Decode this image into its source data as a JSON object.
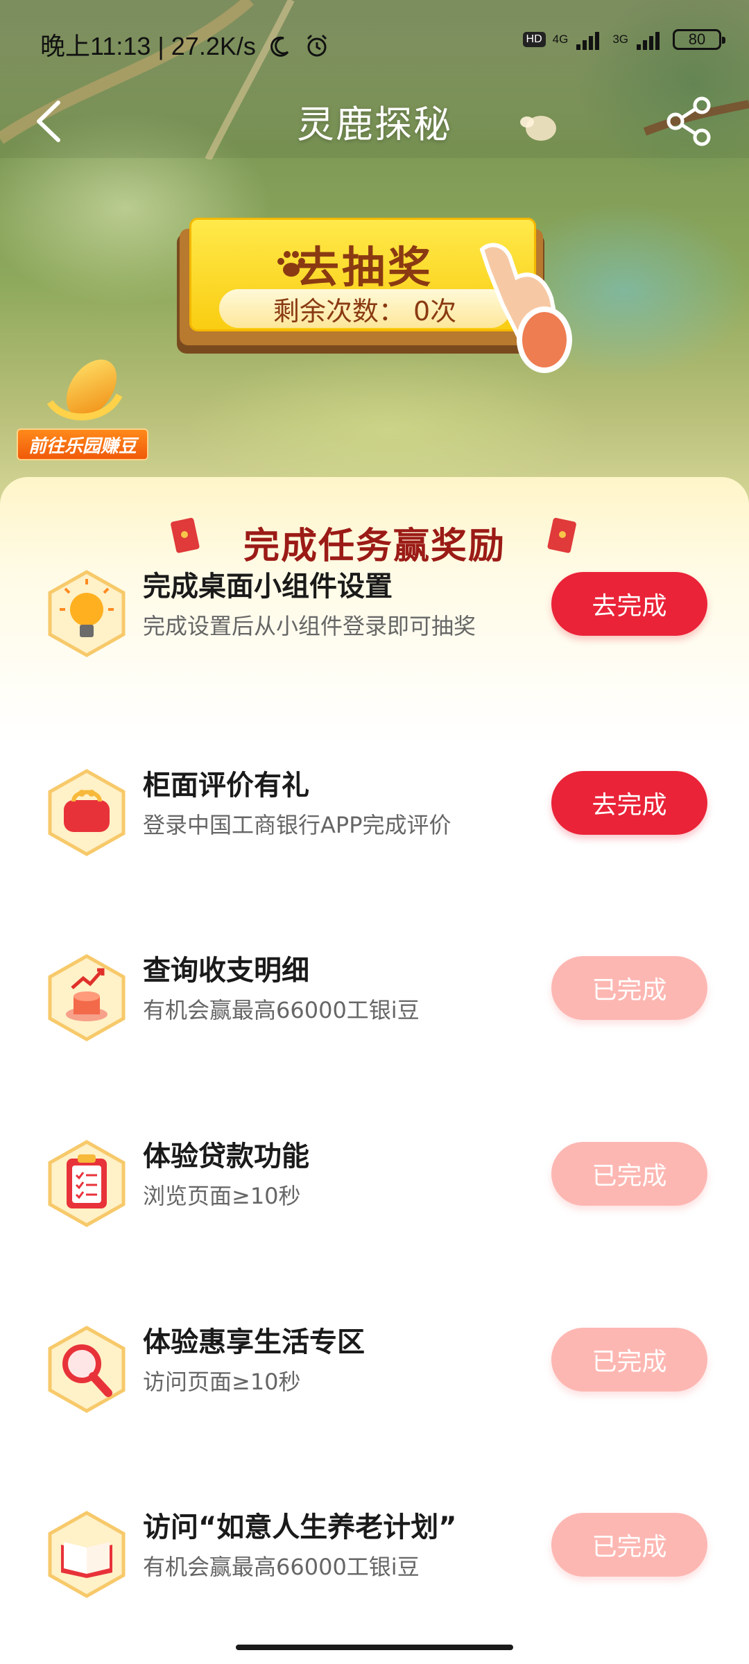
{
  "status_bar": {
    "time": "晚上11:13 | 27.2K/s",
    "hd_label": "HD",
    "net1_label": "4G",
    "net2_label": "3G",
    "battery": "80"
  },
  "nav": {
    "title": "灵鹿探秘"
  },
  "lottery": {
    "title": "去抽奖",
    "remaining": "剩余次数：  0次"
  },
  "farm": {
    "label": "前往乐园赚豆"
  },
  "tasks_section": {
    "title": "完成任务赢奖励",
    "items": [
      {
        "title": "完成桌面小组件设置",
        "desc": "完成设置后从小组件登录即可抽奖",
        "button": "去完成",
        "icon": "lightbulb-icon",
        "done": false
      },
      {
        "title": "柜面评价有礼",
        "desc": "登录中国工商银行APP完成评价",
        "button": "去完成",
        "icon": "wallet-icon",
        "done": false
      },
      {
        "title": "查询收支明细",
        "desc": "有机会赢最高66000工银i豆",
        "button": "已完成",
        "icon": "chart-icon",
        "done": true
      },
      {
        "title": "体验贷款功能",
        "desc": "浏览页面≥10秒",
        "button": "已完成",
        "icon": "clipboard-icon",
        "done": true
      },
      {
        "title": "体验惠享生活专区",
        "desc": "访问页面≥10秒",
        "button": "已完成",
        "icon": "magnifier-icon",
        "done": true
      },
      {
        "title": "访问“如意人生养老计划”",
        "desc": "有机会赢最高66000工银i豆",
        "button": "已完成",
        "icon": "book-icon",
        "done": true
      }
    ]
  },
  "colors": {
    "todo_button": "#ea2338",
    "done_button": "#fdb7b2",
    "section_title": "#9b1b16"
  }
}
